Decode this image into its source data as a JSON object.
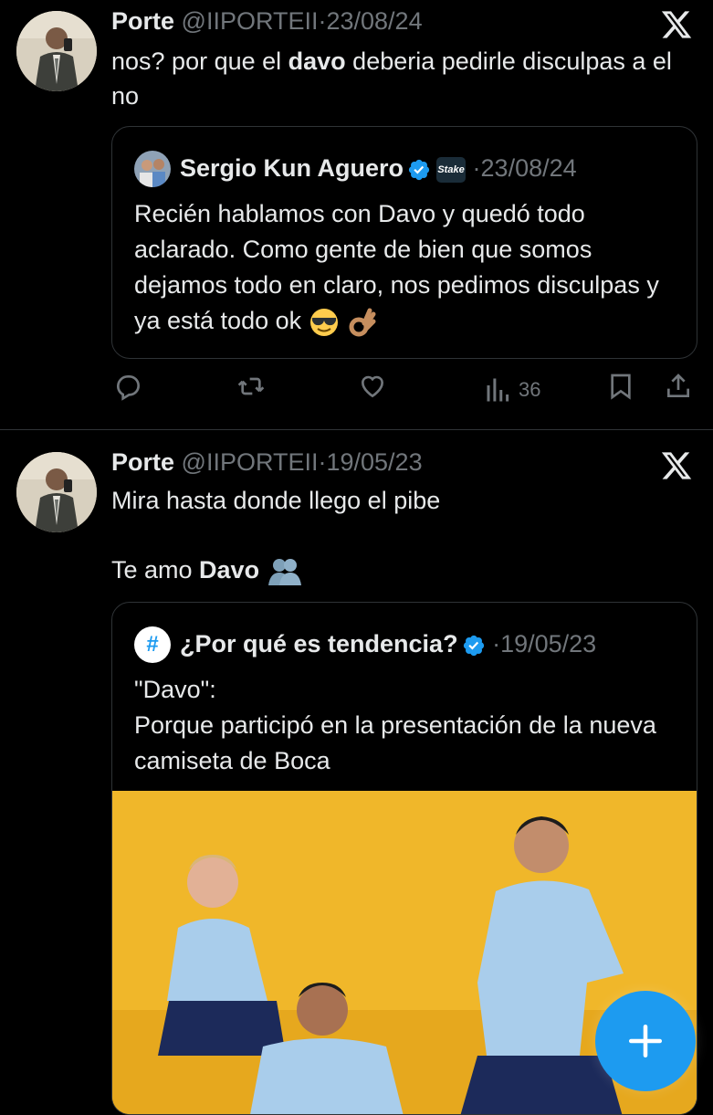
{
  "colors": {
    "background": "#000000",
    "text": "#e7e9ea",
    "muted": "#71767b",
    "border": "#2f3336",
    "accent": "#1d9bf0",
    "photo_backdrop": "#f0b72a",
    "jersey": "#a9cdeb"
  },
  "tweet1": {
    "name": "Porte",
    "handle": "@IIPORTEII",
    "separator": "·",
    "date": "23/08/24",
    "text_before": "nos? por que el ",
    "text_bold": "davo",
    "text_after": " deberia pedirle disculpas a el no",
    "quote": {
      "name": "Sergio Kun Aguero",
      "badge": "Stake",
      "separator": "·",
      "date": "23/08/24",
      "text": "Recién hablamos con Davo y quedó todo aclarado. Como gente de bien que somos dejamos todo en claro, nos pedimos disculpas y ya está todo ok"
    },
    "actions": {
      "views": "36"
    }
  },
  "tweet2": {
    "name": "Porte",
    "handle": "@IIPORTEII",
    "separator": "·",
    "date": "19/05/23",
    "line1": "Mira hasta donde llego el pibe",
    "line2_before": "Te amo ",
    "line2_bold": "Davo",
    "quote": {
      "name": "¿Por qué es tendencia?",
      "separator": "·",
      "date": "19/05/23",
      "text_title": "\"Davo\":",
      "text": "Porque participó en la presentación de la nueva camiseta de Boca"
    }
  },
  "icons": {
    "x_logo": "x-logo-icon",
    "reply": "reply-icon",
    "retweet": "retweet-icon",
    "like": "heart-icon",
    "views": "views-icon",
    "bookmark": "bookmark-icon",
    "share": "share-icon",
    "compose": "plus-icon"
  }
}
